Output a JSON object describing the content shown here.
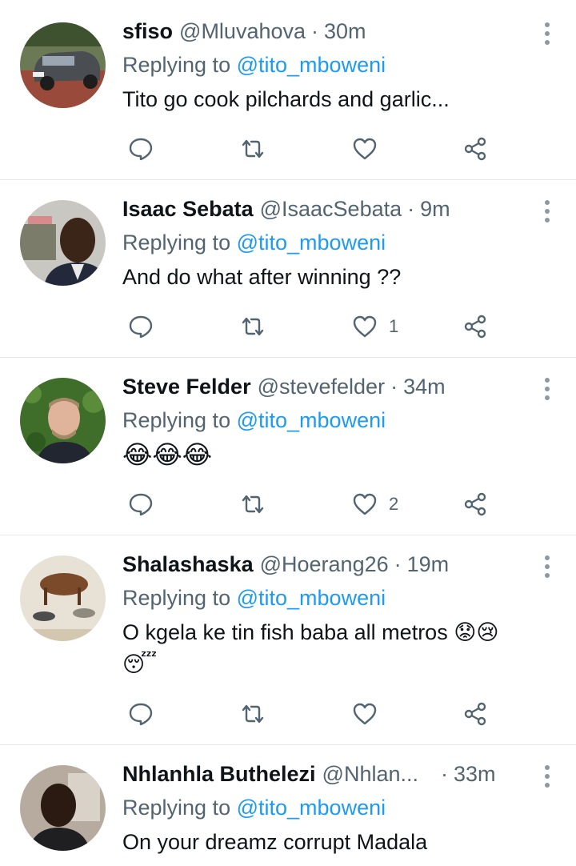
{
  "tweets": [
    {
      "name": "sfiso",
      "handle": "@Mluvahova",
      "separator": "·",
      "time": "30m",
      "replying_prefix": "Replying to",
      "replying_to": "@tito_mboweni",
      "text": "Tito go cook pilchards and garlic...",
      "likes": ""
    },
    {
      "name": "Isaac Sebata",
      "handle": "@IsaacSebata",
      "separator": "·",
      "time": "9m",
      "replying_prefix": "Replying to",
      "replying_to": "@tito_mboweni",
      "text": "And do what after winning ??",
      "likes": "1"
    },
    {
      "name": "Steve Felder",
      "handle": "@stevefelder",
      "separator": "·",
      "time": "34m",
      "replying_prefix": "Replying to",
      "replying_to": "@tito_mboweni",
      "text": "😂😂😂",
      "likes": "2"
    },
    {
      "name": "Shalashaska",
      "handle": "@Hoerang26",
      "separator": "·",
      "time": "19m",
      "replying_prefix": "Replying to",
      "replying_to": "@tito_mboweni",
      "text": "O kgela ke tin fish baba all metros 😟😢",
      "text_line2": "😴",
      "likes": ""
    },
    {
      "name": "Nhlanhla Buthelezi",
      "handle": "@Nhlan...",
      "separator": "·",
      "time": "33m",
      "replying_prefix": "Replying to",
      "replying_to": "@tito_mboweni",
      "text": "On your dreamz corrupt  Madala",
      "likes": ""
    }
  ],
  "icons": {
    "reply": "comment-icon",
    "retweet": "retweet-icon",
    "like": "heart-icon",
    "share": "share-icon",
    "more": "more-vertical-icon"
  },
  "colors": {
    "mention": "#1d9bf0",
    "secondary_text": "#536471",
    "icon": "#536471"
  }
}
